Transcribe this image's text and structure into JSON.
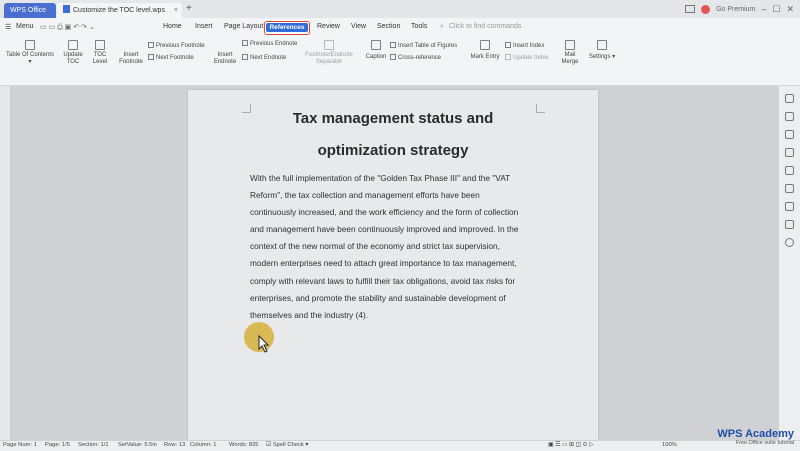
{
  "titlebar": {
    "app_tab": "WPS Office",
    "doc_tab": "Customize the TOC level.wps",
    "new_tab": "+",
    "user": "Go Premium"
  },
  "menubar": {
    "menu_label": "Menu",
    "items": [
      "Home",
      "Insert",
      "Page Layout",
      "References",
      "Review",
      "View",
      "Section",
      "Tools"
    ],
    "active": "References",
    "search_placeholder": "Click to find commands"
  },
  "ribbon": {
    "toc": "Table Of Contents",
    "update_toc": [
      "Update",
      "TOC"
    ],
    "toc_level": [
      "TOC",
      "Level"
    ],
    "insert_footnote": [
      "Insert",
      "Footnote"
    ],
    "prev_footnote": "Previous Footnote",
    "next_footnote": "Next Footnote",
    "insert_endnote": [
      "Insert",
      "Endnote"
    ],
    "prev_endnote": "Previous Endnote",
    "next_endnote": "Next Endnote",
    "separator": [
      "Footnote/Endnote",
      "Separator"
    ],
    "caption": "Caption",
    "insert_table_figures": "Insert Table of Figures",
    "cross_reference": "Cross-reference",
    "mark_entry": "Mark Entry",
    "insert_index": "Insert Index",
    "update_index": "Update Index",
    "mail_merge": [
      "Mail",
      "Merge"
    ],
    "settings": "Settings"
  },
  "document": {
    "title_line1": "Tax management status and",
    "title_line2": "optimization strategy",
    "body_lines": [
      "With the full implementation of the \"Golden Tax Phase III\" and the \"VAT",
      "Reform\", the tax collection and management efforts have been",
      "continuously increased, and the work efficiency and the form of collection",
      "and management have been continuously improved and improved. In the",
      "context of the new normal of the economy and strict tax supervision,",
      "modern enterprises need to attach great importance to tax management,",
      "comply with relevant laws to fulfill their tax obligations, avoid tax risks for",
      "enterprises, and promote the stability and sustainable development of",
      "themselves and the industry (4)."
    ]
  },
  "statusbar": {
    "page_num": "Page Num: 1",
    "page": "Page: 1/5",
    "section": "Section: 1/1",
    "setvalue": "SetValue: 5.5in",
    "row": "Row: 13",
    "column": "Column: 1",
    "words": "Words: 825",
    "spell": "Spell Check",
    "zoom": "100%"
  },
  "watermark": {
    "brand": "WPS Academy",
    "tagline": "Free Office suite tutorial"
  }
}
